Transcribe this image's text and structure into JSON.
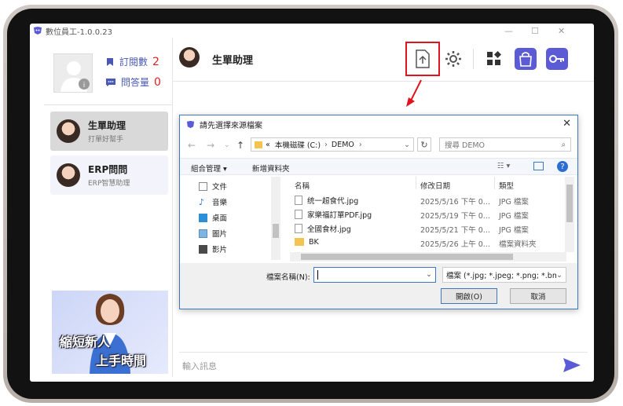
{
  "window": {
    "title": "數位員工-1.0.0.23"
  },
  "sidebar": {
    "subscriptions_label": "訂閱數",
    "subscriptions_count": "2",
    "questions_label": "問答量",
    "questions_count": "0",
    "agents": [
      {
        "name": "生單助理",
        "subtitle": "打單好幫手"
      },
      {
        "name": "ERP問問",
        "subtitle": "ERP智慧助理"
      }
    ],
    "banner_line1": "縮短新人",
    "banner_line2": "上手時間"
  },
  "header": {
    "title": "生單助理"
  },
  "chat": {
    "placeholder": "輸入訊息"
  },
  "dialog": {
    "title": "請先選擇來源檔案",
    "path_prefix": "«",
    "path_segments": [
      "本機磁碟 (C:)",
      "DEMO"
    ],
    "search_placeholder": "搜尋 DEMO",
    "organize_label": "組合管理 ▾",
    "new_folder_label": "新增資料夾",
    "tree": [
      "文件",
      "音樂",
      "桌面",
      "圖片",
      "影片"
    ],
    "columns": {
      "name": "名稱",
      "date": "修改日期",
      "type": "類型"
    },
    "files": [
      {
        "name": "统一超食代.jpg",
        "date": "2025/5/16 下午 0...",
        "type": "JPG 檔案",
        "kind": "file"
      },
      {
        "name": "家樂福訂單PDF.jpg",
        "date": "2025/5/19 下午 0...",
        "type": "JPG 檔案",
        "kind": "file"
      },
      {
        "name": "全國食材.jpg",
        "date": "2025/5/21 下午 0...",
        "type": "JPG 檔案",
        "kind": "file"
      },
      {
        "name": "BK",
        "date": "2025/5/26 上午 0...",
        "type": "檔案資料夾",
        "kind": "folder"
      }
    ],
    "filename_label": "檔案名稱(N):",
    "filename_value": "",
    "filetype_value": "檔案 (*.jpg; *.jpeg; *.png; *.bm",
    "open_label": "開啟(O)",
    "cancel_label": "取消"
  },
  "colors": {
    "accent": "#5b5bd6",
    "highlight": "#e0141e",
    "link": "#4a5ab2"
  }
}
